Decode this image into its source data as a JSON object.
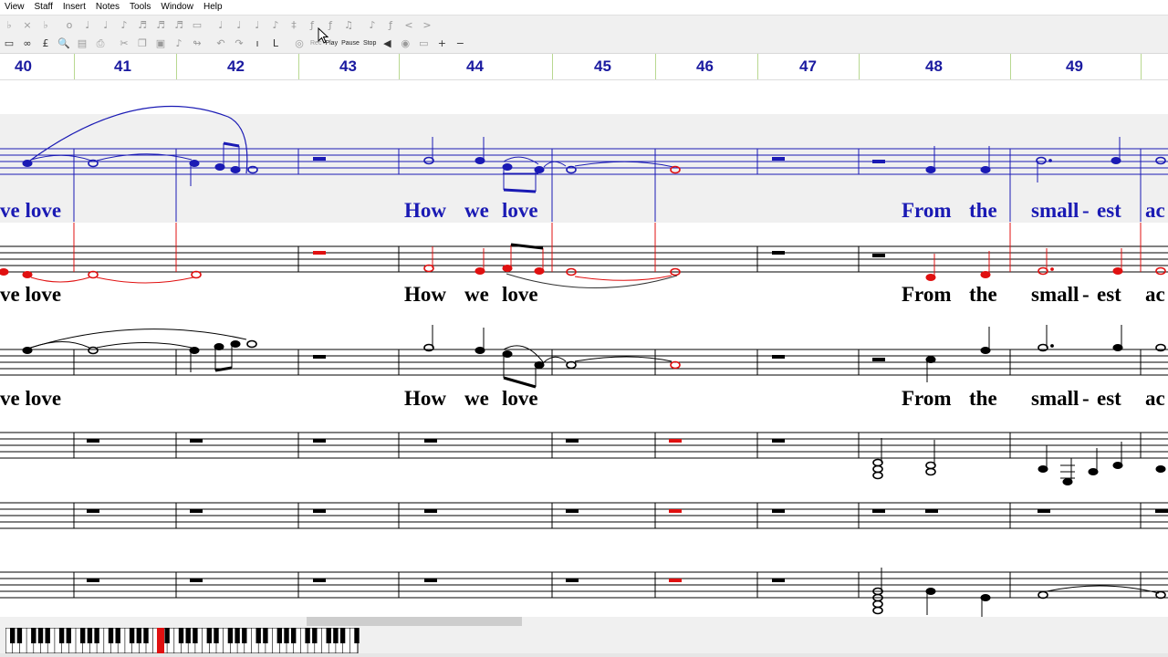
{
  "menu": [
    "View",
    "Staff",
    "Insert",
    "Notes",
    "Tools",
    "Window",
    "Help"
  ],
  "toolbar1_icons": [
    "flat-icon",
    "cross-icon",
    "double-flat-icon",
    "whole-note-icon",
    "half-note-icon",
    "quarter-note-icon",
    "eighth-note-icon",
    "sixteenth-note-icon",
    "thirtysecond-note-icon",
    "sixtyfourth-note-icon",
    "dot-icon",
    "rest-box-icon",
    "grace-note-icon",
    "dotted-note-icon",
    "tied-note-icon",
    "slur-note-icon",
    "staccato-icon",
    "accent-icon",
    "fermata-icon",
    "trill-icon",
    "triplet-icon",
    "crescendo-icon",
    "decrescendo-icon"
  ],
  "toolbar2": {
    "rec": "Rec",
    "play": "Play",
    "pause": "Pause",
    "stop": "Stop"
  },
  "measures": [
    "40",
    "41",
    "42",
    "43",
    "44",
    "45",
    "46",
    "47",
    "48",
    "49"
  ],
  "lyrics": {
    "line1": [
      "ve love",
      "How",
      "we",
      "love",
      "From",
      "the",
      "small",
      "-",
      "est",
      "ac"
    ],
    "line2": [
      "ve love",
      "How",
      "we",
      "love",
      "From",
      "the",
      "small",
      "-",
      "est",
      "ac"
    ],
    "line3": [
      "ve love",
      "How",
      "we",
      "love",
      "From",
      "the",
      "small",
      "-",
      "est",
      "ac"
    ]
  },
  "colors": {
    "staff_blue": "#1a1ab4",
    "staff_red": "#e01010",
    "measure_number": "#1a1aa0",
    "selected_band": "#f0f0f0"
  }
}
